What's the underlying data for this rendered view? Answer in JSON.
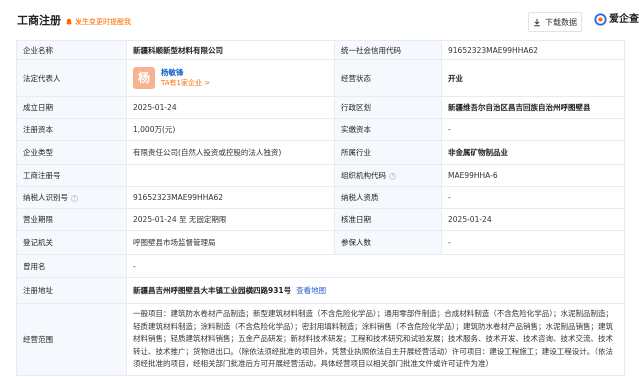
{
  "header": {
    "title": "工商注册",
    "alert": "发生变更时提醒我",
    "download_label": "下载数据",
    "logo_text": "爱企查"
  },
  "colors": {
    "accent_orange": "#ff6a00",
    "link_blue": "#1a63c8",
    "label_bg": "#f5f8fc"
  },
  "rows": {
    "r1": {
      "l1": "企业名称",
      "v1": "新疆科顺新型材料有限公司",
      "l2": "统一社会信用代码",
      "v2": "91652323MAE99HHA62"
    },
    "r2": {
      "l1": "法定代表人",
      "avatar": "杨",
      "name": "杨敏锋",
      "sub": "TA有1家企业 >",
      "l2": "经营状态",
      "v2": "开业"
    },
    "r3": {
      "l1": "成立日期",
      "v1": "2025-01-24",
      "l2": "行政区划",
      "v2": "新疆维吾尔自治区昌吉回族自治州呼图壁县"
    },
    "r4": {
      "l1": "注册资本",
      "v1": "1,000万(元)",
      "l2": "实缴资本",
      "v2": "-"
    },
    "r5": {
      "l1": "企业类型",
      "v1": "有限责任公司(自然人投资或控股的法人独资)",
      "l2": "所属行业",
      "v2": "非金属矿物制品业"
    },
    "r6": {
      "l1": "工商注册号",
      "v1": "",
      "l2": "组织机构代码",
      "v2": "MAE99HHA-6"
    },
    "r7": {
      "l1": "纳税人识别号",
      "v1": "91652323MAE99HHA62",
      "l2": "纳税人资质",
      "v2": "-"
    },
    "r8": {
      "l1": "营业期限",
      "v1": "2025-01-24 至 无固定期限",
      "l2": "核准日期",
      "v2": "2025-01-24"
    },
    "r9": {
      "l1": "登记机关",
      "v1": "呼图壁县市场监督管理局",
      "l2": "参保人数",
      "v2": "-"
    },
    "r10": {
      "l1": "曾用名",
      "v1": "-"
    },
    "r11": {
      "l1": "注册地址",
      "v1": "新疆昌吉州呼图壁县大丰镇工业园横四路931号",
      "link": "查看地图"
    },
    "r12": {
      "l1": "经营范围",
      "v1": "一般项目：建筑防水卷材产品制造；新型建筑材料制造（不含危险化学品）；通用零部件制造；合成材料制造（不含危险化学品）；水泥制品制造；轻质建筑材料制造；涂料制造（不含危险化学品）；密封用填料制造；涂料销售（不含危险化学品）；建筑防水卷材产品销售；水泥制品销售；建筑材料销售；轻质建筑材料销售；五金产品研发；新材料技术研发；工程和技术研究和试验发展；技术服务、技术开发、技术咨询、技术交流、技术转让、技术推广；货物进出口。（除依法须经批准的项目外，凭营业执照依法自主开展经营活动）许可项目：建设工程施工；建设工程设计。（依法须经批准的项目，经相关部门批准后方可开展经营活动，具体经营项目以相关部门批准文件或许可证件为准）"
    }
  }
}
